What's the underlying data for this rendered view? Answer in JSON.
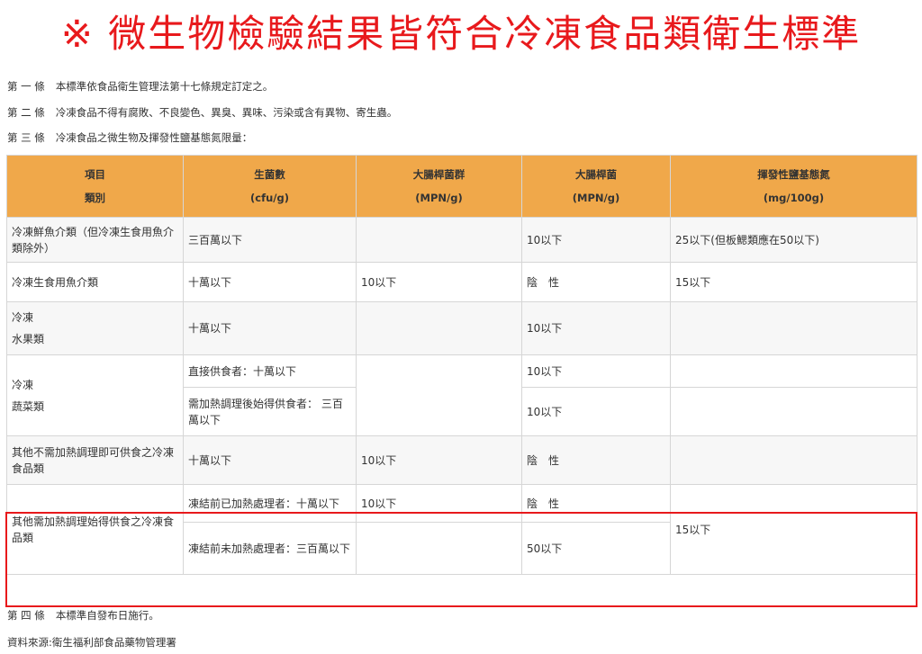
{
  "headline": "※ 微生物檢驗結果皆符合冷凍食品類衛生標準",
  "clauses": [
    {
      "num": "第 一 條",
      "text": "本標準依食品衛生管理法第十七條規定訂定之。"
    },
    {
      "num": "第 二 條",
      "text": "冷凍食品不得有腐敗、不良變色、異臭、異味、污染或含有異物、寄生蟲。"
    },
    {
      "num": "第 三 條",
      "text": "冷凍食品之微生物及揮發性鹽基態氮限量："
    },
    {
      "num": "第 四 條",
      "text": "本標準自發布日施行。"
    }
  ],
  "source": "資料來源:衛生福利部食品藥物管理署",
  "table": {
    "headers": [
      {
        "line1": "項目",
        "line2": "類別"
      },
      {
        "line1": "生菌數",
        "line2": "(cfu/g)"
      },
      {
        "line1": "大腸桿菌群",
        "line2": "(MPN/g)"
      },
      {
        "line1": "大腸桿菌",
        "line2": "(MPN/g)"
      },
      {
        "line1": "揮發性鹽基態氮",
        "line2": "(mg/100g)"
      }
    ],
    "fish": {
      "category": "冷凍鮮魚介類（但冷凍生食用魚介類除外）",
      "bacteria": "三百萬以下",
      "coliform": "",
      "ecoli": "10以下",
      "vbn": "25以下(但板鰓類應在50以下)"
    },
    "raw_fish": {
      "category": "冷凍生食用魚介類",
      "bacteria": "十萬以下",
      "coliform": "10以下",
      "ecoli": "陰　性",
      "vbn": "15以下"
    },
    "fruit": {
      "category_line1": "冷凍",
      "category_line2": "水果類",
      "bacteria": "十萬以下",
      "coliform": "",
      "ecoli": "10以下",
      "vbn": ""
    },
    "veg": {
      "category_line1": "冷凍",
      "category_line2": "蔬菜類",
      "bacteria_a": "直接供食者：十萬以下",
      "ecoli_a": "10以下",
      "bacteria_b": "需加熱調理後始得供食者： 三百萬以下",
      "ecoli_b": "10以下"
    },
    "ready": {
      "category": "其他不需加熱調理即可供食之冷凍食品類",
      "bacteria": "十萬以下",
      "coliform": "10以下",
      "ecoli": "陰　性",
      "vbn": ""
    },
    "cook": {
      "category": "其他需加熱調理始得供食之冷凍食品類",
      "bacteria_a": "凍結前已加熱處理者：十萬以下",
      "coliform_a": "10以下",
      "ecoli_a": "陰　性",
      "bacteria_b": "凍結前未加熱處理者：三百萬以下",
      "ecoli_b": "50以下",
      "vbn": "15以下"
    }
  },
  "colors": {
    "headline": "#e8191c",
    "header_bg": "#f0a84a",
    "highlight": "#e8191c"
  }
}
